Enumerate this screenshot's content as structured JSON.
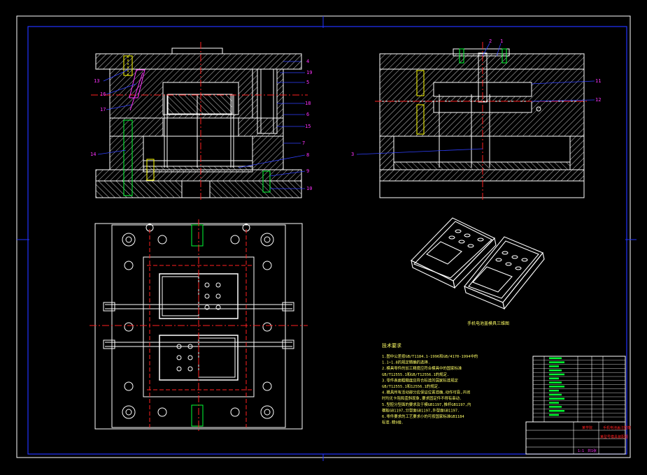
{
  "colors": {
    "background": "#000000",
    "border": "#2233ff",
    "outline": "#ffffff",
    "hatch": "#ffffff",
    "centerline": "#ff2020",
    "dim": "#3040ff",
    "label": "#ff33ff",
    "bolt": "#ffff00",
    "green": "#00ff33",
    "text": "#ffff66"
  },
  "front_view": {
    "callouts_right": [
      "4",
      "19",
      "5",
      "18",
      "6",
      "15",
      "7",
      "8",
      "9",
      "10"
    ],
    "callouts_left": [
      "13",
      "16",
      "17",
      "14"
    ]
  },
  "side_view": {
    "callouts_top": [
      "2",
      "1"
    ],
    "callouts_right": [
      "11",
      "12"
    ],
    "callouts_left": [
      "3"
    ]
  },
  "iso_caption": "手机电池盖模具三维图",
  "notes": {
    "title": "技术要求",
    "lines": [
      "1.图中公差按GB/T1184.1-1996和GB/4170-1994中的",
      "1.1~1.8的规定精确的选择.",
      "2.模具零件的加工精度应符合模具中的国家标准",
      "GB/T12555.1和GB/T12556.1的规定.",
      "3.零件表面粗糙度应符合标准的国家标准规定",
      "GB/T12555.1和12556.1的规定.",
      "4.模具所有活动部分应保证位置准确,动作可靠,开闭",
      "时均无卡阻和歪斜现象,要求固定件不得有串动.",
      "5.型腔分型面的要求及于模GB1197,推杆GB1197,内",
      "模板GB1197,分型面GB1197,外型面GB1197.",
      "6.零件要求的工艺要求小的可按国家标准GB1184",
      "标准-精9级."
    ]
  },
  "title_block": {
    "school": "某学院",
    "drawing_name": "手机电池盖注塑模",
    "subtitle": "某型号模具装配图",
    "scale": "1:1",
    "sheet": "共1张"
  }
}
